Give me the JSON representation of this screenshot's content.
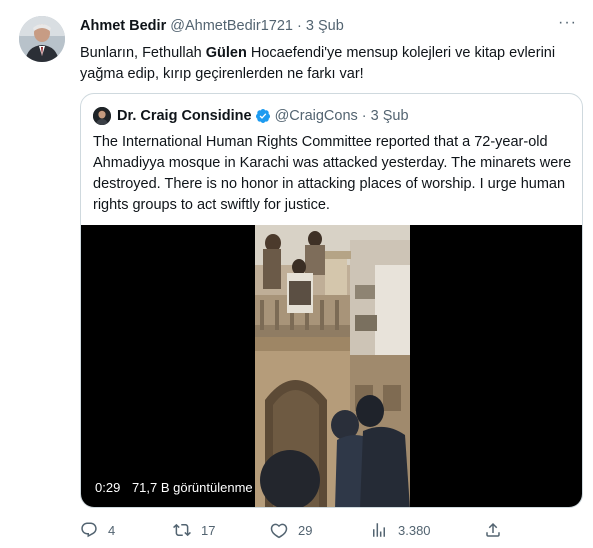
{
  "tweet": {
    "author_name": "Ahmet Bedir",
    "handle": "@AhmetBedir1721",
    "dot": "·",
    "time": "3 Şub",
    "more": "···",
    "text_before": "Bunların, Fethullah ",
    "text_bold": "Gülen",
    "text_after": " Hocaefendi'ye mensup kolejleri ve kitap evlerini yağma edip, kırıp geçirenlerden ne farkı var!"
  },
  "quoted": {
    "author_name": "Dr. Craig Considine",
    "handle": "@CraigCons",
    "dot": "·",
    "time": "3 Şub",
    "text": "The International Human Rights Committee reported that a 72-year-old Ahmadiyya mosque in Karachi was attacked yesterday. The minarets were destroyed. There is no honor in attacking places of worship. I urge human rights groups to act swiftly for justice.",
    "video": {
      "duration": "0:29",
      "views": "71,7 B görüntülenme"
    }
  },
  "actions": {
    "reply_count": "4",
    "retweet_count": "17",
    "like_count": "29",
    "views_count": "3.380"
  },
  "icons": [
    "more-icon",
    "verified-icon",
    "reply-icon",
    "retweet-icon",
    "like-icon",
    "views-icon",
    "share-icon"
  ],
  "colors": {
    "verified": "#1d9bf0",
    "muted": "#536471",
    "border": "#cfd9de"
  }
}
